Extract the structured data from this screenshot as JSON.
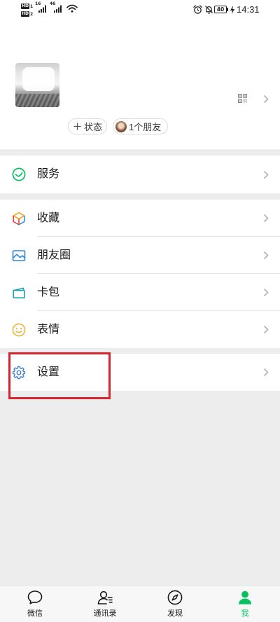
{
  "theme": {
    "accent": "#07c160",
    "background": "#ededed",
    "annotation": "#d9232e"
  },
  "status_bar": {
    "sim1": {
      "badge": "HD",
      "slot": "1",
      "network_type": "16"
    },
    "sim2": {
      "badge": "HD",
      "slot": "2",
      "network_type": "46"
    },
    "wifi_icon": "wifi-icon",
    "alarm_icon": "alarm-icon",
    "silent_icon": "bell-off-icon",
    "battery_level": "40",
    "charging_icon": "charging-bolt-icon",
    "time": "14:31"
  },
  "profile": {
    "qr_icon": "qr-code-icon",
    "status_button": {
      "icon": "plus-icon",
      "label": "状态"
    },
    "friends_button": {
      "label": "1个朋友"
    }
  },
  "menu": {
    "items": [
      {
        "label": "服务",
        "icon": "wechat-pay-icon",
        "color": "#07c160"
      },
      {
        "label": "收藏",
        "icon": "favorites-cube-icon",
        "colors": [
          "#f5a623",
          "#e64340",
          "#3b8ae6"
        ]
      },
      {
        "label": "朋友圈",
        "icon": "moments-photo-icon",
        "color": "#2e86de"
      },
      {
        "label": "卡包",
        "icon": "card-wallet-icon",
        "color": "#1aa3b0"
      },
      {
        "label": "表情",
        "icon": "sticker-smiley-icon",
        "color": "#f0b43c"
      },
      {
        "label": "设置",
        "icon": "settings-gear-icon",
        "color": "#3b7fd1"
      }
    ]
  },
  "bottom_nav": {
    "items": [
      {
        "label": "微信",
        "icon": "chat-bubble-icon"
      },
      {
        "label": "通讯录",
        "icon": "contacts-icon"
      },
      {
        "label": "发现",
        "icon": "compass-icon"
      },
      {
        "label": "我",
        "icon": "person-icon",
        "active": true
      }
    ]
  }
}
